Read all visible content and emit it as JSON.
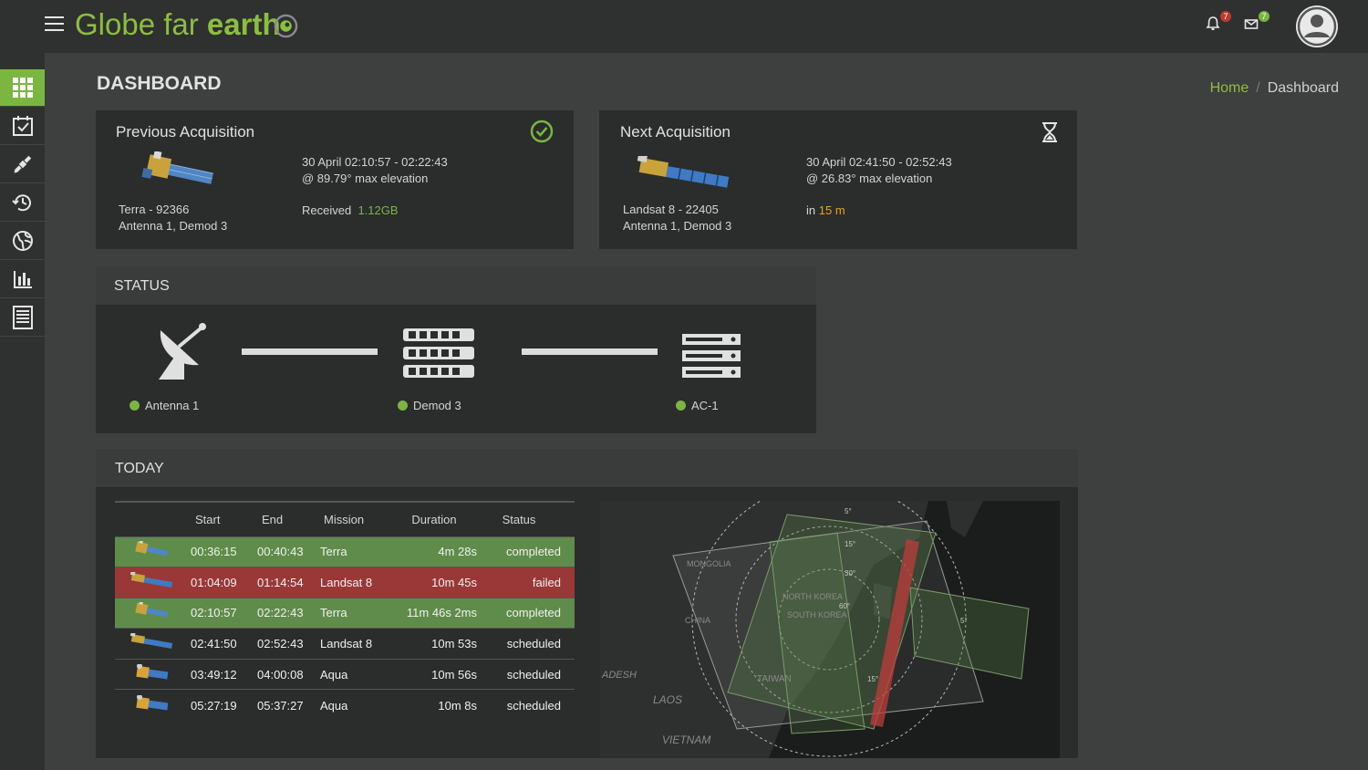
{
  "app": {
    "name_part1": "Globe far ",
    "name_part2": "earth",
    "notifications_count": "7",
    "messages_count": "7"
  },
  "sidebar": {
    "items": [
      {
        "icon": "grid-icon",
        "active": true
      },
      {
        "icon": "calendar-check-icon",
        "active": false
      },
      {
        "icon": "satellite-icon",
        "active": false
      },
      {
        "icon": "history-icon",
        "active": false
      },
      {
        "icon": "globe-icon",
        "active": false
      },
      {
        "icon": "bar-chart-icon",
        "active": false
      },
      {
        "icon": "document-icon",
        "active": false
      }
    ]
  },
  "header": {
    "title": "DASHBOARD",
    "breadcrumb": {
      "home": "Home",
      "separator": "/",
      "current": "Dashboard"
    }
  },
  "previous": {
    "title": "Previous Acquisition",
    "satellite": "Terra - 92366",
    "antenna": "Antenna 1, Demod 3",
    "time": "30 April 02:10:57 - 02:22:43",
    "elevation": "@ 89.79° max elevation",
    "received_label": "Received",
    "received_value": "1.12GB"
  },
  "next": {
    "title": "Next Acquisition",
    "satellite": "Landsat 8 - 22405",
    "antenna": "Antenna 1, Demod 3",
    "time": "30 April 02:41:50 - 02:52:43",
    "elevation": "@ 26.83° max elevation",
    "in_label": "in",
    "in_value": "15 m"
  },
  "status": {
    "title": "STATUS",
    "nodes": [
      {
        "label": "Antenna 1",
        "state": "ok"
      },
      {
        "label": "Demod 3",
        "state": "ok"
      },
      {
        "label": "AC-1",
        "state": "ok"
      }
    ]
  },
  "today": {
    "title": "TODAY",
    "columns": [
      "Start",
      "End",
      "Mission",
      "Duration",
      "Status"
    ],
    "rows": [
      {
        "start": "00:36:15",
        "end": "00:40:43",
        "mission": "Terra",
        "duration": "4m 28s",
        "status": "completed"
      },
      {
        "start": "01:04:09",
        "end": "01:14:54",
        "mission": "Landsat 8",
        "duration": "10m 45s",
        "status": "failed"
      },
      {
        "start": "02:10:57",
        "end": "02:22:43",
        "mission": "Terra",
        "duration": "11m 46s 2ms",
        "status": "completed"
      },
      {
        "start": "02:41:50",
        "end": "02:52:43",
        "mission": "Landsat 8",
        "duration": "10m 53s",
        "status": "scheduled"
      },
      {
        "start": "03:49:12",
        "end": "04:00:08",
        "mission": "Aqua",
        "duration": "10m 56s",
        "status": "scheduled"
      },
      {
        "start": "05:27:19",
        "end": "05:37:27",
        "mission": "Aqua",
        "duration": "10m 8s",
        "status": "scheduled"
      }
    ],
    "map_labels": [
      "MONGOLIA",
      "CHINA",
      "NORTH KOREA",
      "SOUTH KOREA",
      "TAIWAN",
      "LAOS",
      "VIETNAM",
      "ADESH",
      "5°",
      "15°",
      "30°",
      "60°",
      "5°",
      "15°"
    ]
  },
  "colors": {
    "accent": "#7ab640",
    "failed": "#9a3838",
    "completed": "#5f8c4a",
    "warning": "#e8a317"
  }
}
